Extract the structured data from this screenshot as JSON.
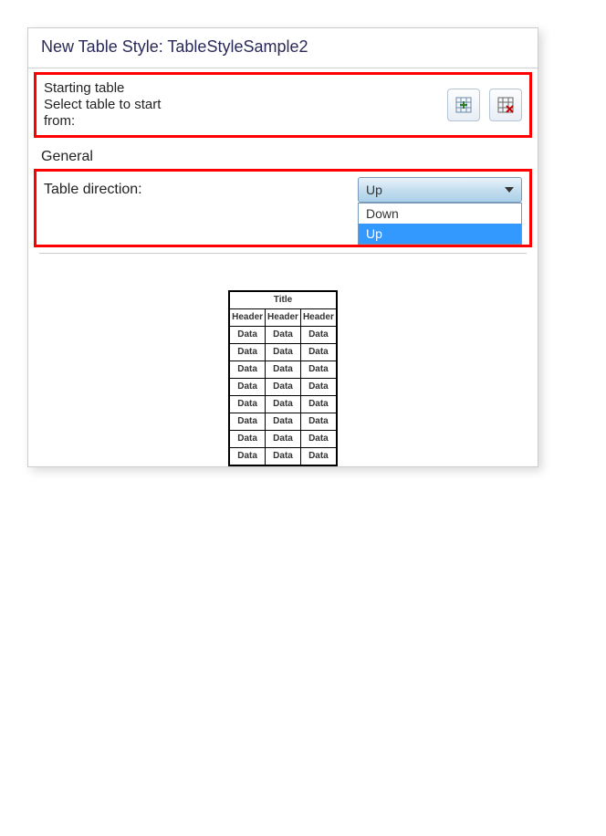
{
  "title": "New Table Style: TableStyleSample2",
  "starting": {
    "label1": "Starting table",
    "label2": "Select table to start",
    "label3": "from:"
  },
  "general": {
    "heading": "General",
    "direction_label": "Table direction:",
    "direction_selected": "Up",
    "direction_options": [
      "Down",
      "Up"
    ]
  },
  "preview": {
    "title": "Title",
    "headers": [
      "Header",
      "Header",
      "Header"
    ],
    "rows": [
      [
        "Data",
        "Data",
        "Data"
      ],
      [
        "Data",
        "Data",
        "Data"
      ],
      [
        "Data",
        "Data",
        "Data"
      ],
      [
        "Data",
        "Data",
        "Data"
      ],
      [
        "Data",
        "Data",
        "Data"
      ],
      [
        "Data",
        "Data",
        "Data"
      ],
      [
        "Data",
        "Data",
        "Data"
      ],
      [
        "Data",
        "Data",
        "Data"
      ]
    ]
  }
}
